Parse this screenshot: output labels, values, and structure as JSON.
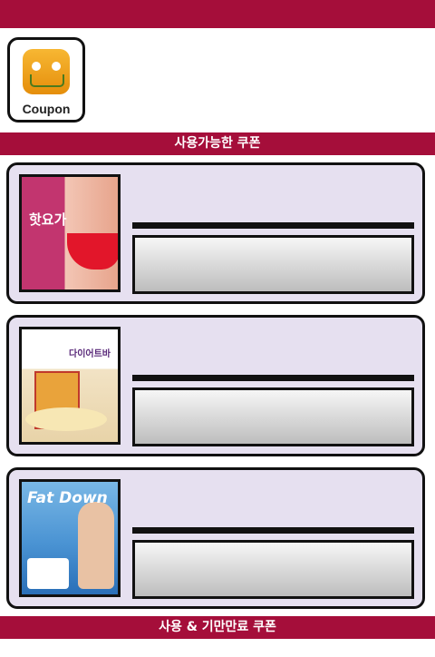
{
  "app": {
    "icon_label": "Coupon",
    "icon_name": "coupon-cart-icon"
  },
  "sections": {
    "available": "사용가능한 쿠폰",
    "used_expired": "사용 & 기만만료 쿠폰"
  },
  "coupons": [
    {
      "image_name": "hot-yoga-ad-image",
      "image_text": "핫요가"
    },
    {
      "image_name": "diet-bar-ad-image",
      "image_text": "다이어트바"
    },
    {
      "image_name": "fatdown-ad-image",
      "image_text": "Fat Down"
    }
  ],
  "colors": {
    "brand": "#a50e3a",
    "card_bg": "#e6e0f0"
  }
}
